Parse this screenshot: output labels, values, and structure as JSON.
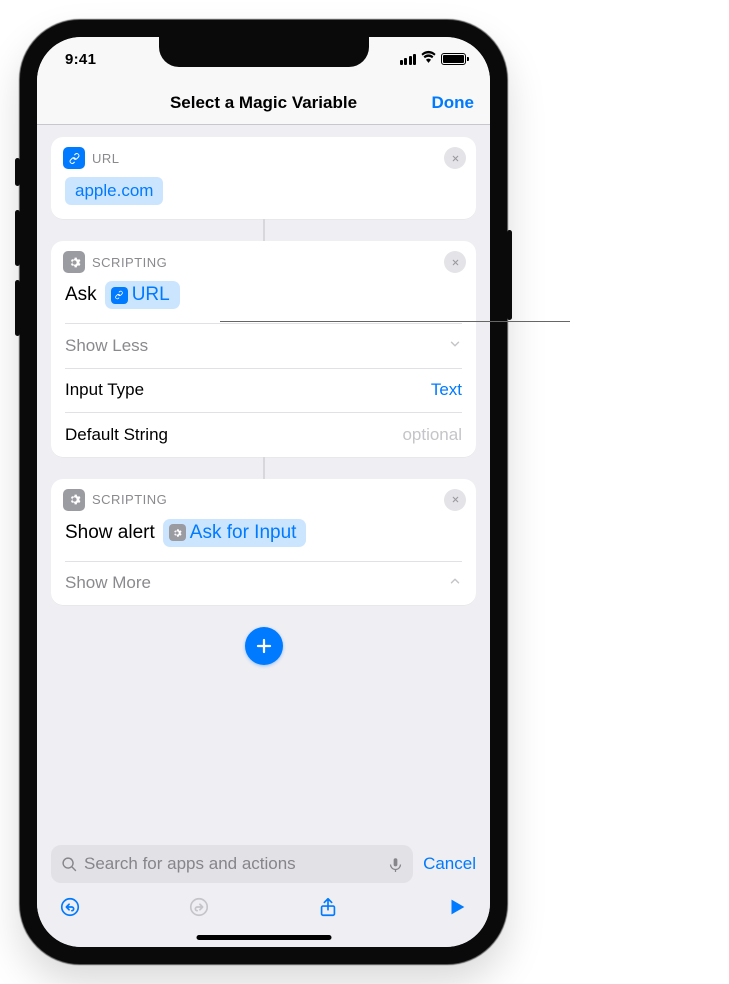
{
  "status": {
    "time": "9:41"
  },
  "nav": {
    "title": "Select a Magic Variable",
    "done": "Done"
  },
  "card_url": {
    "section_label": "URL",
    "value": "apple.com"
  },
  "card_ask": {
    "section_label": "SCRIPTING",
    "verb": "Ask",
    "pill": "URL",
    "show_less": "Show Less",
    "rows": {
      "input_type_label": "Input Type",
      "input_type_value": "Text",
      "default_string_label": "Default String",
      "default_string_placeholder": "optional"
    }
  },
  "card_alert": {
    "section_label": "SCRIPTING",
    "verb": "Show alert",
    "pill": "Ask for Input",
    "show_more": "Show More"
  },
  "search": {
    "placeholder": "Search for apps and actions",
    "cancel": "Cancel"
  }
}
